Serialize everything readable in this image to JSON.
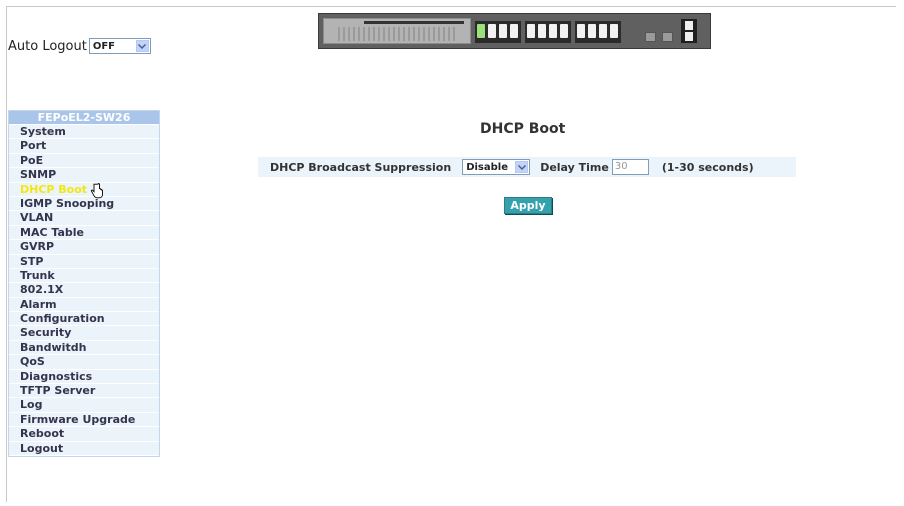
{
  "auto_logout": {
    "label": "Auto Logout",
    "value": "OFF"
  },
  "sidebar": {
    "header": "FEPoEL2-SW26",
    "items": [
      {
        "label": "System"
      },
      {
        "label": "Port"
      },
      {
        "label": "PoE"
      },
      {
        "label": "SNMP"
      },
      {
        "label": "DHCP Boot",
        "active": true
      },
      {
        "label": "IGMP Snooping"
      },
      {
        "label": "VLAN"
      },
      {
        "label": "MAC Table"
      },
      {
        "label": "GVRP"
      },
      {
        "label": "STP"
      },
      {
        "label": "Trunk"
      },
      {
        "label": "802.1X"
      },
      {
        "label": "Alarm"
      },
      {
        "label": "Configuration"
      },
      {
        "label": "Security"
      },
      {
        "label": "Bandwitdh"
      },
      {
        "label": "QoS"
      },
      {
        "label": "Diagnostics"
      },
      {
        "label": "TFTP Server"
      },
      {
        "label": "Log"
      },
      {
        "label": "Firmware Upgrade"
      },
      {
        "label": "Reboot"
      },
      {
        "label": "Logout"
      }
    ]
  },
  "main": {
    "title": "DHCP Boot",
    "suppression_label": "DHCP Broadcast Suppression",
    "suppression_value": "Disable",
    "delay_label": "Delay Time",
    "delay_value": "30",
    "delay_range": "(1-30 seconds)",
    "apply_label": "Apply"
  },
  "colors": {
    "sidebar_bg": "#ebf3fb",
    "sidebar_header": "#a9c6ea",
    "active_item": "#f2e80f",
    "apply_button": "#35a1ad"
  }
}
